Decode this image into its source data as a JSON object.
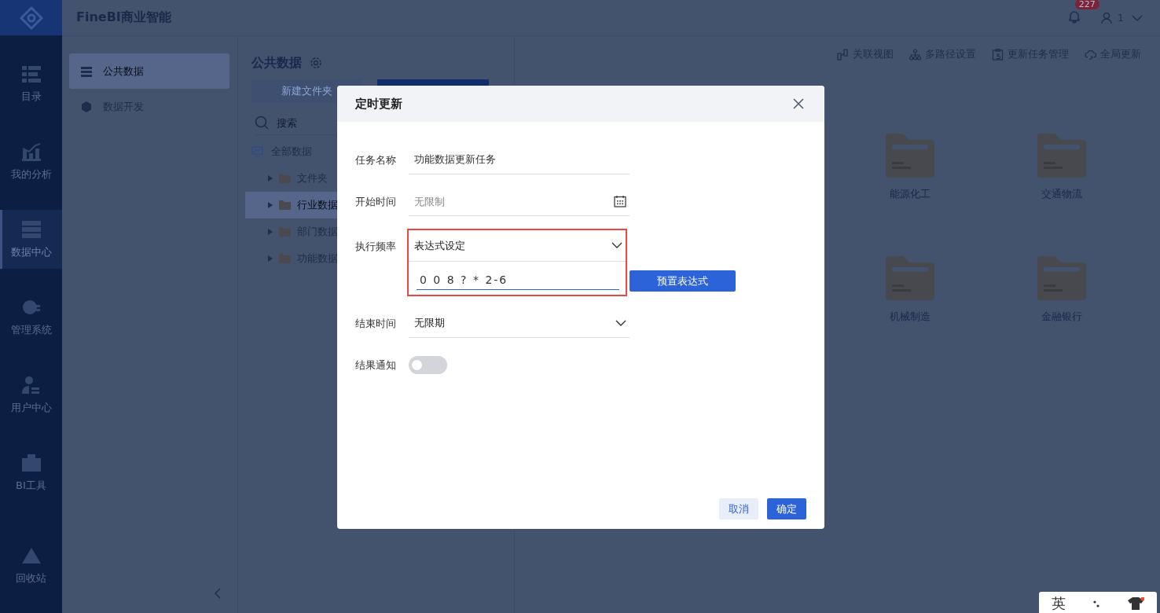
{
  "app": {
    "title": "FineBI商业智能",
    "notifications": "227",
    "user": "1"
  },
  "nav": [
    {
      "label": "目录",
      "selected": false
    },
    {
      "label": "我的分析",
      "selected": false
    },
    {
      "label": "数据中心",
      "selected": true
    },
    {
      "label": "管理系统",
      "selected": false
    },
    {
      "label": "用户中心",
      "selected": false
    },
    {
      "label": "BI工具",
      "selected": false
    },
    {
      "label": "回收站",
      "selected": false
    }
  ],
  "subnav": [
    {
      "label": "公共数据",
      "selected": true
    },
    {
      "label": "数据开发",
      "selected": false
    }
  ],
  "panel": {
    "title": "公共数据",
    "new_folder": "新建文件夹",
    "search": {
      "placeholder": "搜索"
    },
    "tree": {
      "label": "全部数据",
      "children": [
        {
          "label": "文件夹",
          "selected": false
        },
        {
          "label": "行业数据",
          "selected": true
        },
        {
          "label": "部门数据",
          "selected": false
        },
        {
          "label": "功能数据",
          "selected": false
        }
      ]
    }
  },
  "toolbar": [
    "关联视图",
    "多路径设置",
    "更新任务管理",
    "全局更新"
  ],
  "folders": [
    "能源化工",
    "交通物流",
    "机械制造",
    "金融银行"
  ],
  "dialog": {
    "title": "定时更新",
    "fields": [
      {
        "kind": "text",
        "label": "任务名称",
        "value": "功能数据更新任务"
      },
      {
        "kind": "date",
        "label": "开始时间",
        "placeholder": "无限制"
      },
      {
        "kind": "expression",
        "label": "执行频率",
        "value": "表达式设定",
        "expression": "0 0 8 ? * 2-6",
        "button": "预置表达式",
        "highlighted": true
      },
      {
        "kind": "select",
        "label": "结束时间",
        "value": "无限期"
      },
      {
        "kind": "toggle",
        "label": "结果通知",
        "on": false
      }
    ],
    "cancel": "取消",
    "ok": "确定"
  },
  "ime": {
    "label": "英"
  }
}
